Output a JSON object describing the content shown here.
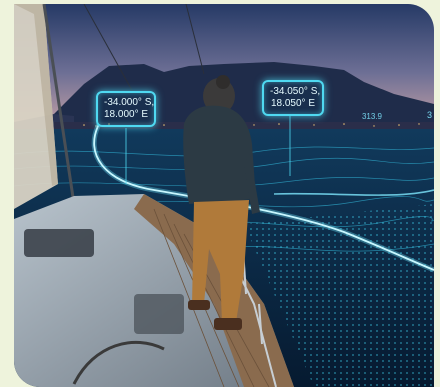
{
  "scene": {
    "labels": [
      {
        "lat": "-34.000° S,",
        "lon": "18.000° E"
      },
      {
        "lat": "-34.050° S,",
        "lon": "18.050° E"
      }
    ],
    "far_readout": "313.9",
    "far_readout_2": "3"
  },
  "colors": {
    "background": "#eef3dc",
    "sky_top": "#2b3f6b",
    "sky_bottom": "#c9a3a6",
    "mountain": "#1f2c4a",
    "sea": "#08243f",
    "hud_cyan": "#4fd9f1"
  }
}
